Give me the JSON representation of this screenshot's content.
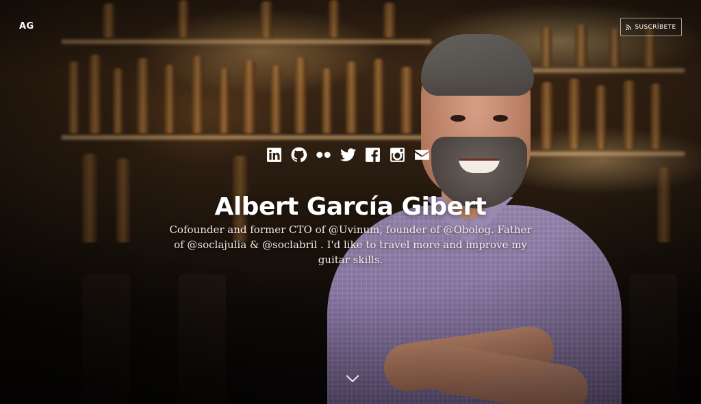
{
  "header": {
    "logo_text": "AG",
    "subscribe_label": "SUSCRÍBETE",
    "subscribe_icon": "rss-icon"
  },
  "social": [
    {
      "icon": "linkedin-icon"
    },
    {
      "icon": "github-icon"
    },
    {
      "icon": "flickr-icon"
    },
    {
      "icon": "twitter-icon"
    },
    {
      "icon": "facebook-icon"
    },
    {
      "icon": "instagram-icon"
    },
    {
      "icon": "email-icon"
    }
  ],
  "hero": {
    "name": "Albert García Gibert",
    "bio": "Cofounder and former CTO of @Uvinum, founder of @Obolog. Father of @soclajulia & @soclabril . I'd like to travel more and improve my guitar skills.",
    "scroll_icon": "chevron-down-icon"
  },
  "colors": {
    "text": "#ffffff",
    "background_dark": "#0d0906"
  }
}
